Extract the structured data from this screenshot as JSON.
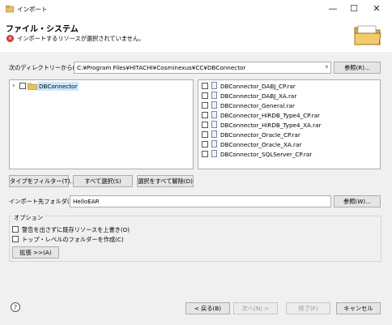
{
  "window": {
    "title": "インポート",
    "minimize_glyph": "—",
    "maximize_glyph": "☐",
    "close_glyph": "✕"
  },
  "header": {
    "title": "ファイル・システム",
    "error_glyph": "×",
    "error_message": "インポートするリソースが選択されていません。",
    "icon": "folder-icon"
  },
  "source": {
    "label": "次のディレクトリーから(Y):",
    "path": "C:¥Program Files¥HITACHI¥Cosminexus¥CC¥DBConnector",
    "dropdown_glyph": "∨",
    "browse_label": "参照(R)..."
  },
  "tree": {
    "expander_glyph": "›",
    "items": [
      {
        "label": "DBConnector"
      }
    ]
  },
  "files": [
    "DBConnector_DABJ_CP.rar",
    "DBConnector_DABJ_XA.rar",
    "DBConnector_General.rar",
    "DBConnector_HiRDB_Type4_CP.rar",
    "DBConnector_HiRDB_Type4_XA.rar",
    "DBConnector_Oracle_CP.rar",
    "DBConnector_Oracle_XA.rar",
    "DBConnector_SQLServer_CP.rar"
  ],
  "selection_buttons": {
    "filter": "タイプをフィルター(T)...",
    "select_all": "すべて選択(S)",
    "deselect_all": "選択をすべて解除(D)"
  },
  "destination": {
    "label": "インポート先フォルダ(L):",
    "value": "HelloEAR",
    "browse_label": "参照(W)..."
  },
  "options": {
    "group_label": "オプション",
    "overwrite": "警告を出さずに既存リソースを上書き(O)",
    "create_top_folders": "トップ・レベルのフォルダーを作成(C)",
    "advanced": "拡張 >>(A)"
  },
  "footer": {
    "help_glyph": "?",
    "back": "< 戻る(B)",
    "next": "次へ(N) >",
    "finish": "終了(F)",
    "cancel": "キャンセル"
  }
}
